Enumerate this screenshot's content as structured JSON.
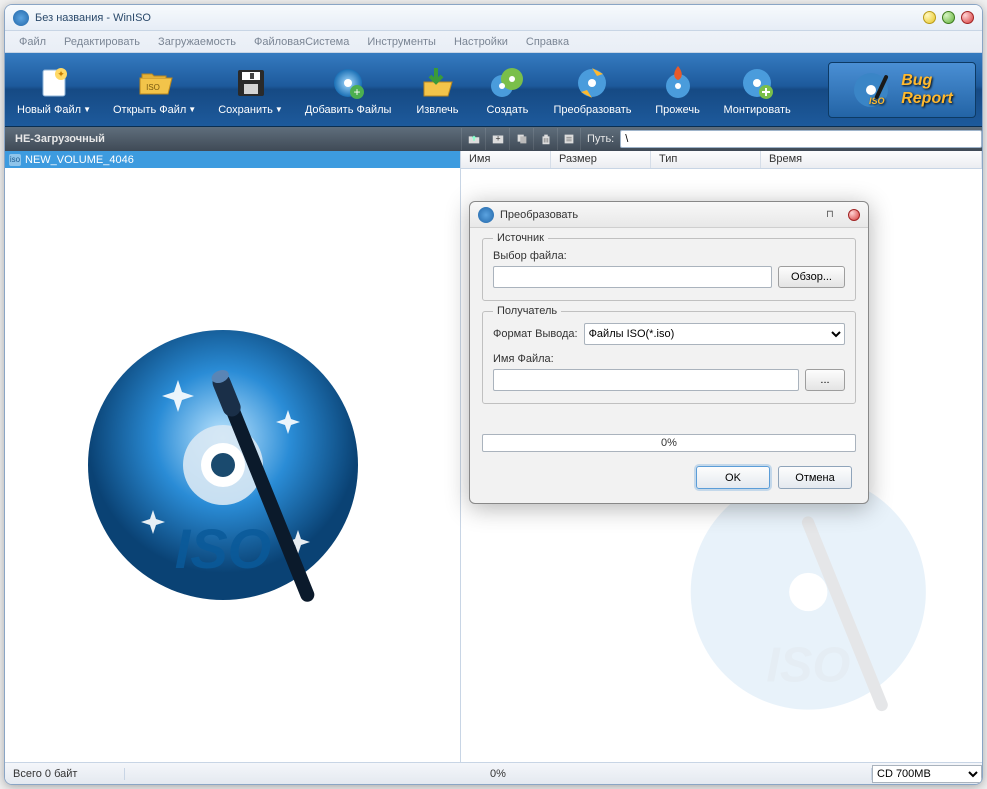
{
  "window": {
    "title": "Без названия - WinISO"
  },
  "menu": {
    "file": "Файл",
    "edit": "Редактировать",
    "bootable": "Загружаемость",
    "filesystem": "ФайловаяСистема",
    "tools": "Инструменты",
    "options": "Настройки",
    "help": "Справка"
  },
  "toolbar": {
    "newfile": "Новый Файл",
    "openfile": "Открыть Файл",
    "save": "Сохранить",
    "addfiles": "Добавить Файлы",
    "extract": "Извлечь",
    "create": "Создать",
    "convert": "Преобразовать",
    "burn": "Прожечь",
    "mount": "Монтировать",
    "bugreport_line1": "Bug",
    "bugreport_line2": "Report"
  },
  "subbar": {
    "boot": "НЕ-Загрузочный",
    "path_label": "Путь:",
    "path_value": "\\"
  },
  "tree": {
    "volume": "NEW_VOLUME_4046"
  },
  "columns": {
    "name": "Имя",
    "size": "Размер",
    "type": "Тип",
    "time": "Время"
  },
  "dialog": {
    "title": "Преобразовать",
    "source_legend": "Источник",
    "select_file": "Выбор файла:",
    "browse": "Обзор...",
    "dest_legend": "Получатель",
    "output_format": "Формат Вывода:",
    "format_value": "Файлы ISO(*.iso)",
    "filename": "Имя Файла:",
    "ellipsis": "...",
    "progress": "0%",
    "ok": "OK",
    "cancel": "Отмена"
  },
  "status": {
    "total": "Всего 0 байт",
    "percent": "0%",
    "media": "CD 700MB"
  }
}
